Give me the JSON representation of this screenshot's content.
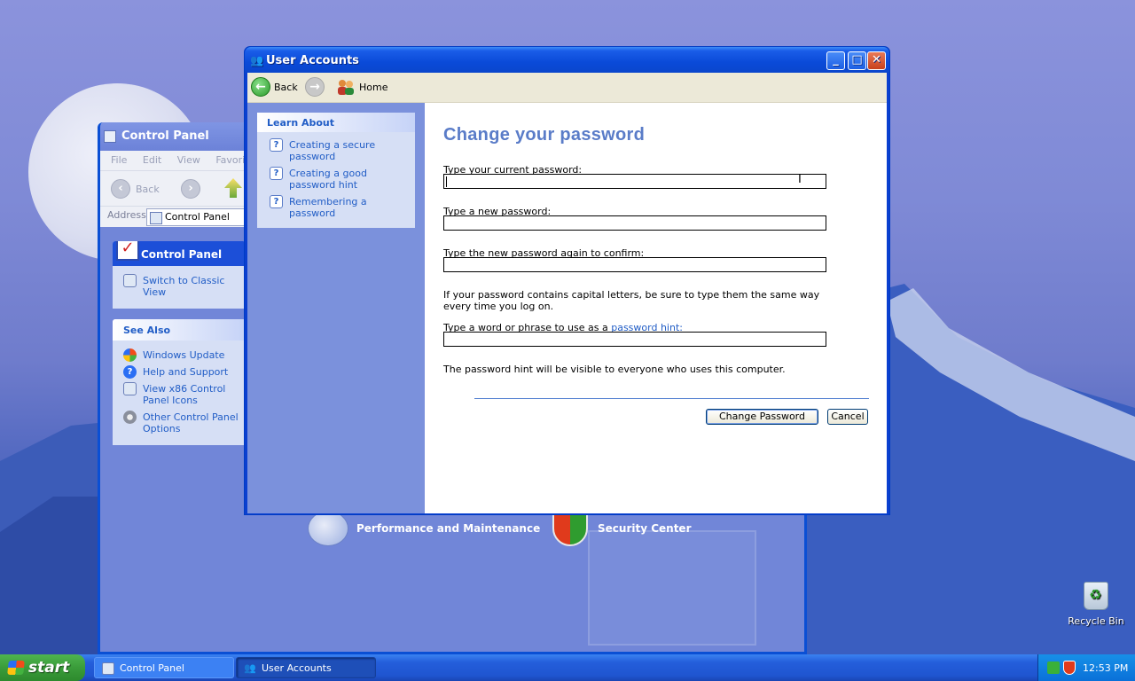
{
  "desktop": {
    "recycle_bin_label": "Recycle Bin"
  },
  "control_panel": {
    "title": "Control Panel",
    "menu": [
      "File",
      "Edit",
      "View",
      "Favorites"
    ],
    "back_label": "Back",
    "address_label": "Address",
    "address_value": "Control Panel",
    "side_header": "Control Panel",
    "switch_view_label": "Switch to Classic View",
    "see_also_header": "See Also",
    "see_also": [
      {
        "label": "Windows Update",
        "icon": "windows-update-icon"
      },
      {
        "label": "Help and Support",
        "icon": "help-icon"
      },
      {
        "label": "View x86 Control Panel Icons",
        "icon": "control-panel-icon"
      },
      {
        "label": "Other Control Panel Options",
        "icon": "gear-icon"
      }
    ],
    "categories": [
      {
        "label": "Performance and Maintenance",
        "icon": "performance-icon"
      },
      {
        "label": "Security Center",
        "icon": "shield-icon"
      }
    ]
  },
  "user_accounts": {
    "title": "User Accounts",
    "toolbar": {
      "back_label": "Back",
      "home_label": "Home"
    },
    "learn_about": {
      "header": "Learn About",
      "items": [
        "Creating a secure password",
        "Creating a good password hint",
        "Remembering a password"
      ]
    },
    "form": {
      "heading": "Change your password",
      "current_label": "Type your current password:",
      "current_value": "",
      "new_label": "Type a new password:",
      "new_value": "",
      "confirm_label": "Type the new password again to confirm:",
      "confirm_value": "",
      "caps_note": "If your password contains capital letters, be sure to type them the same way every time you log on.",
      "hint_label_prefix": "Type a word or phrase to use as a ",
      "hint_link": "password hint:",
      "hint_value": "",
      "hint_note": "The password hint will be visible to everyone who uses this computer.",
      "change_button": "Change Password",
      "cancel_button": "Cancel"
    }
  },
  "taskbar": {
    "start_label": "start",
    "tasks": [
      {
        "label": "Control Panel",
        "active": false
      },
      {
        "label": "User Accounts",
        "active": true
      }
    ],
    "clock": "12:53 PM"
  }
}
